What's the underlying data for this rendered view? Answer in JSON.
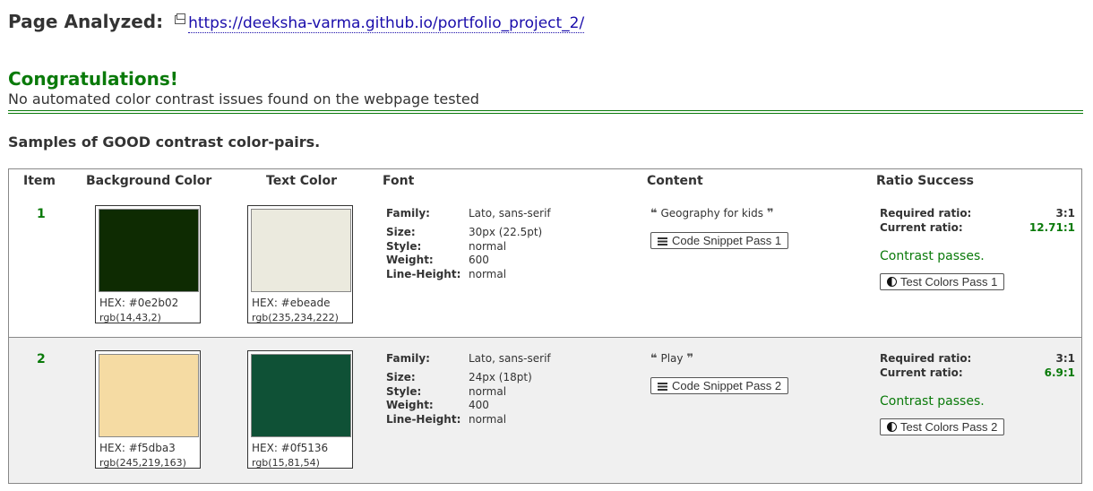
{
  "header": {
    "label": "Page Analyzed:",
    "url": "https://deeksha-varma.github.io/portfolio_project_2/"
  },
  "result": {
    "title": "Congratulations!",
    "message": "No automated color contrast issues found on the webpage tested"
  },
  "samples_title": "Samples of GOOD contrast color-pairs.",
  "table": {
    "headers": {
      "item": "Item",
      "background": "Background Color",
      "text": "Text Color",
      "font": "Font",
      "content": "Content",
      "ratio": "Ratio Success"
    },
    "labels": {
      "family": "Family:",
      "size": "Size:",
      "style": "Style:",
      "weight": "Weight:",
      "line_height": "Line-Height:",
      "required": "Required ratio:",
      "current": "Current ratio:",
      "passes": "Contrast passes."
    },
    "rows": [
      {
        "item": "1",
        "bg_hex_label": "HEX: #0e2b02",
        "bg_rgb": "rgb(14,43,2)",
        "bg_color": "#0e2b02",
        "text_hex_label": "HEX: #ebeade",
        "text_rgb": "rgb(235,234,222)",
        "text_color": "#ebeade",
        "family": "Lato, sans-serif",
        "size": "30px (22.5pt)",
        "style": "normal",
        "weight": "600",
        "line_height": "normal",
        "content": "Geography for kids",
        "snippet_button": "Code Snippet Pass 1",
        "required_ratio": "3:1",
        "current_ratio": "12.71:1",
        "test_button": "Test Colors Pass 1"
      },
      {
        "item": "2",
        "bg_hex_label": "HEX: #f5dba3",
        "bg_rgb": "rgb(245,219,163)",
        "bg_color": "#f5dba3",
        "text_hex_label": "HEX: #0f5136",
        "text_rgb": "rgb(15,81,54)",
        "text_color": "#0f5136",
        "family": "Lato, sans-serif",
        "size": "24px (18pt)",
        "style": "normal",
        "weight": "400",
        "line_height": "normal",
        "content": "Play",
        "snippet_button": "Code Snippet Pass 2",
        "required_ratio": "3:1",
        "current_ratio": "6.9:1",
        "test_button": "Test Colors Pass 2"
      }
    ]
  },
  "colors": {
    "success": "#0a7a0a",
    "link": "#1a0dab"
  }
}
